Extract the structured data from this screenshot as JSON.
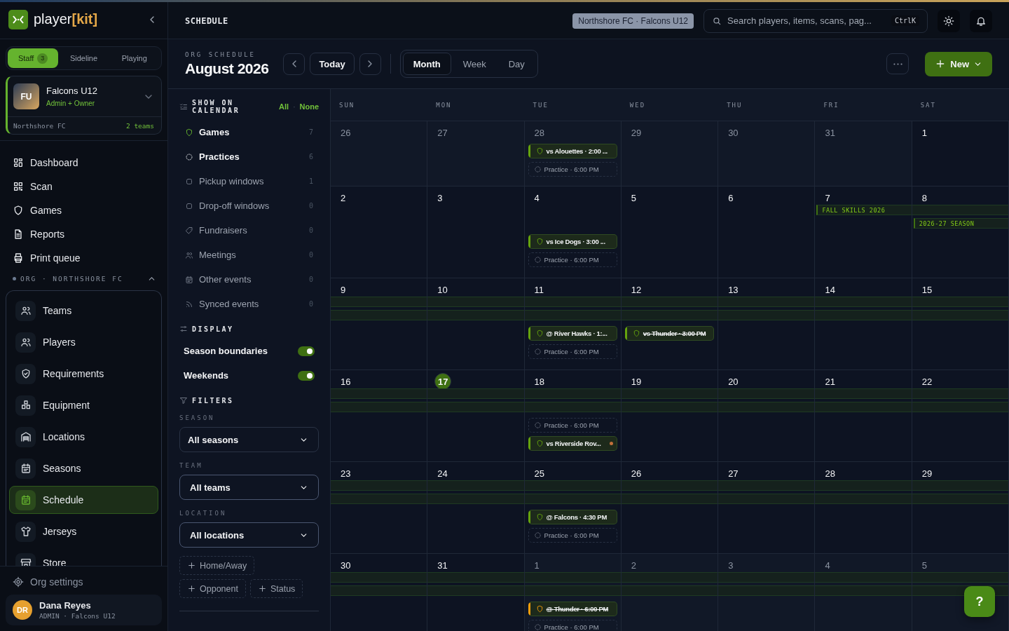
{
  "sidebar": {
    "logo": {
      "text": "player",
      "accent": "[kit]"
    },
    "modes": [
      {
        "label": "Staff",
        "badge": "3",
        "selected": true
      },
      {
        "label": "Sideline",
        "selected": false
      },
      {
        "label": "Playing",
        "selected": false
      }
    ],
    "team_card": {
      "initials": "FU",
      "name": "Falcons U12",
      "role": "Admin + Owner",
      "org": "Northshore FC",
      "team_count": "2 teams"
    },
    "nav": [
      {
        "label": "Dashboard"
      },
      {
        "label": "Scan"
      },
      {
        "label": "Games"
      },
      {
        "label": "Reports"
      },
      {
        "label": "Print queue"
      }
    ],
    "org_section": {
      "title": "ORG · NORTHSHORE FC",
      "expanded": true,
      "items": [
        {
          "label": "Teams",
          "selected": false
        },
        {
          "label": "Players",
          "selected": false
        },
        {
          "label": "Requirements",
          "selected": false
        },
        {
          "label": "Equipment",
          "selected": false
        },
        {
          "label": "Locations",
          "selected": false
        },
        {
          "label": "Seasons",
          "selected": false
        },
        {
          "label": "Schedule",
          "selected": true
        },
        {
          "label": "Jerseys",
          "selected": false
        },
        {
          "label": "Store",
          "selected": false
        }
      ]
    },
    "settings": "Org settings",
    "user": {
      "initials": "DR",
      "name": "Dana Reyes",
      "meta": "ADMIN · Falcons U12"
    }
  },
  "topbar": {
    "title": "SCHEDULE",
    "context": "Northshore FC · Falcons U12",
    "search": {
      "placeholder": "Search players, items, scans, pag...",
      "shortcut": "CtrlK"
    }
  },
  "header": {
    "eyebrow": "ORG SCHEDULE",
    "title": "August 2026",
    "today": "Today",
    "views": [
      {
        "label": "Month",
        "selected": true
      },
      {
        "label": "Week",
        "selected": false
      },
      {
        "label": "Day",
        "selected": false
      }
    ],
    "new_button": "New"
  },
  "filters_panel": {
    "show_title": "SHOW ON CALENDAR",
    "all": "All",
    "separator": "·",
    "none": "None",
    "layers": [
      {
        "label": "Games",
        "count": "7",
        "on": true
      },
      {
        "label": "Practices",
        "count": "6",
        "on": true
      },
      {
        "label": "Pickup windows",
        "count": "1",
        "on": false
      },
      {
        "label": "Drop-off windows",
        "count": "0",
        "on": false
      },
      {
        "label": "Fundraisers",
        "count": "0",
        "on": false
      },
      {
        "label": "Meetings",
        "count": "0",
        "on": false
      },
      {
        "label": "Other events",
        "count": "0",
        "on": false
      },
      {
        "label": "Synced events",
        "count": "0",
        "on": false
      }
    ],
    "display_title": "DISPLAY",
    "display": [
      {
        "label": "Season boundaries",
        "on": true
      },
      {
        "label": "Weekends",
        "on": true
      }
    ],
    "filters_title": "FILTERS",
    "selects": [
      {
        "label": "SEASON",
        "value": "All seasons"
      },
      {
        "label": "TEAM",
        "value": "All teams"
      },
      {
        "label": "LOCATION",
        "value": "All locations"
      }
    ],
    "chips": [
      "Home/Away",
      "Opponent",
      "Status"
    ]
  },
  "calendar": {
    "weekdays": [
      "SUN",
      "MON",
      "TUE",
      "WED",
      "THU",
      "FRI",
      "SAT"
    ],
    "weeks": [
      {
        "days": [
          {
            "n": "26",
            "outside": true
          },
          {
            "n": "27",
            "outside": true
          },
          {
            "n": "28",
            "outside": true,
            "events": [
              {
                "kind": "game",
                "text": "vs Alouettes · 2:00 ...",
                "color": "#65a30d",
                "cancelled": false,
                "alert": false
              },
              {
                "kind": "practice",
                "text": "Practice · 6:00 PM"
              }
            ]
          },
          {
            "n": "29",
            "outside": true
          },
          {
            "n": "30",
            "outside": true
          },
          {
            "n": "31",
            "outside": true
          },
          {
            "n": "1",
            "outside": false
          }
        ]
      },
      {
        "days": [
          {
            "n": "2"
          },
          {
            "n": "3"
          },
          {
            "n": "4",
            "events": [
              {
                "kind": "game",
                "text": "vs Ice Dogs · 3:00 ...",
                "color": "#65a30d",
                "cancelled": false,
                "alert": false
              },
              {
                "kind": "practice",
                "text": "Practice · 6:00 PM"
              }
            ]
          },
          {
            "n": "5"
          },
          {
            "n": "6"
          },
          {
            "n": "7",
            "bands": [
              {
                "kind": "fall",
                "label": "FALL SKILLS 2026"
              }
            ]
          },
          {
            "n": "8",
            "bands": [
              {
                "kind": "fall"
              },
              {
                "kind": "season",
                "label": "2026-27 SEASON"
              }
            ]
          }
        ]
      },
      {
        "days": [
          {
            "n": "9",
            "bands": [
              {
                "kind": "fall"
              },
              {
                "kind": "season"
              }
            ]
          },
          {
            "n": "10",
            "bands": [
              {
                "kind": "fall"
              },
              {
                "kind": "season"
              }
            ]
          },
          {
            "n": "11",
            "bands": [
              {
                "kind": "fall"
              },
              {
                "kind": "season"
              }
            ],
            "events": [
              {
                "kind": "game",
                "text": "@ River Hawks · 1:...",
                "color": "#65a30d",
                "cancelled": false,
                "alert": false
              },
              {
                "kind": "practice",
                "text": "Practice · 6:00 PM"
              }
            ]
          },
          {
            "n": "12",
            "bands": [
              {
                "kind": "fall"
              },
              {
                "kind": "season"
              }
            ],
            "events": [
              {
                "kind": "game",
                "text": "vs Thunder · 3:00 PM",
                "color": "#65a30d",
                "cancelled": true,
                "alert": false
              }
            ]
          },
          {
            "n": "13",
            "bands": [
              {
                "kind": "fall"
              },
              {
                "kind": "season"
              }
            ]
          },
          {
            "n": "14",
            "bands": [
              {
                "kind": "fall"
              },
              {
                "kind": "season"
              }
            ]
          },
          {
            "n": "15",
            "bands": [
              {
                "kind": "fall"
              },
              {
                "kind": "season"
              }
            ]
          }
        ]
      },
      {
        "days": [
          {
            "n": "16",
            "bands": [
              {
                "kind": "fall"
              },
              {
                "kind": "season"
              }
            ]
          },
          {
            "n": "17",
            "today": true,
            "bands": [
              {
                "kind": "fall"
              },
              {
                "kind": "season"
              }
            ]
          },
          {
            "n": "18",
            "bands": [
              {
                "kind": "fall"
              },
              {
                "kind": "season"
              }
            ],
            "events": [
              {
                "kind": "practice",
                "text": "Practice · 6:00 PM"
              },
              {
                "kind": "game",
                "text": "vs Riverside Rov...",
                "color": "#65a30d",
                "cancelled": false,
                "alert": true
              }
            ]
          },
          {
            "n": "19",
            "bands": [
              {
                "kind": "fall"
              },
              {
                "kind": "season"
              }
            ]
          },
          {
            "n": "20",
            "bands": [
              {
                "kind": "fall"
              },
              {
                "kind": "season"
              }
            ]
          },
          {
            "n": "21",
            "bands": [
              {
                "kind": "fall"
              },
              {
                "kind": "season"
              }
            ]
          },
          {
            "n": "22",
            "bands": [
              {
                "kind": "fall"
              },
              {
                "kind": "season"
              }
            ]
          }
        ]
      },
      {
        "days": [
          {
            "n": "23",
            "bands": [
              {
                "kind": "fall"
              },
              {
                "kind": "season"
              }
            ]
          },
          {
            "n": "24",
            "bands": [
              {
                "kind": "fall"
              },
              {
                "kind": "season"
              }
            ]
          },
          {
            "n": "25",
            "bands": [
              {
                "kind": "fall"
              },
              {
                "kind": "season"
              }
            ],
            "events": [
              {
                "kind": "game",
                "text": "@ Falcons · 4:30 PM",
                "color": "#65a30d",
                "cancelled": false,
                "alert": false
              },
              {
                "kind": "practice",
                "text": "Practice · 6:00 PM"
              }
            ]
          },
          {
            "n": "26",
            "bands": [
              {
                "kind": "fall"
              },
              {
                "kind": "season"
              }
            ]
          },
          {
            "n": "27",
            "bands": [
              {
                "kind": "fall"
              },
              {
                "kind": "season"
              }
            ]
          },
          {
            "n": "28",
            "bands": [
              {
                "kind": "fall"
              },
              {
                "kind": "season"
              }
            ]
          },
          {
            "n": "29",
            "bands": [
              {
                "kind": "fall"
              },
              {
                "kind": "season"
              }
            ]
          }
        ]
      },
      {
        "days": [
          {
            "n": "30",
            "bands": [
              {
                "kind": "fall"
              },
              {
                "kind": "season"
              }
            ]
          },
          {
            "n": "31",
            "bands": [
              {
                "kind": "fall"
              },
              {
                "kind": "season"
              }
            ]
          },
          {
            "n": "1",
            "outside": true,
            "bands": [
              {
                "kind": "fall"
              },
              {
                "kind": "season"
              }
            ],
            "events": [
              {
                "kind": "game",
                "text": "@ Thunder · 6:00 PM",
                "color": "#f59e0b",
                "cancelled": true,
                "alert": false
              },
              {
                "kind": "practice",
                "text": "Practice · 6:00 PM"
              }
            ]
          },
          {
            "n": "2",
            "outside": true,
            "bands": [
              {
                "kind": "fall"
              },
              {
                "kind": "season"
              }
            ]
          },
          {
            "n": "3",
            "outside": true,
            "bands": [
              {
                "kind": "fall"
              },
              {
                "kind": "season"
              }
            ]
          },
          {
            "n": "4",
            "outside": true,
            "bands": [
              {
                "kind": "fall"
              },
              {
                "kind": "season"
              }
            ]
          },
          {
            "n": "5",
            "outside": true,
            "bands": [
              {
                "kind": "fall"
              },
              {
                "kind": "season"
              }
            ]
          }
        ]
      }
    ]
  },
  "help_button": "?"
}
